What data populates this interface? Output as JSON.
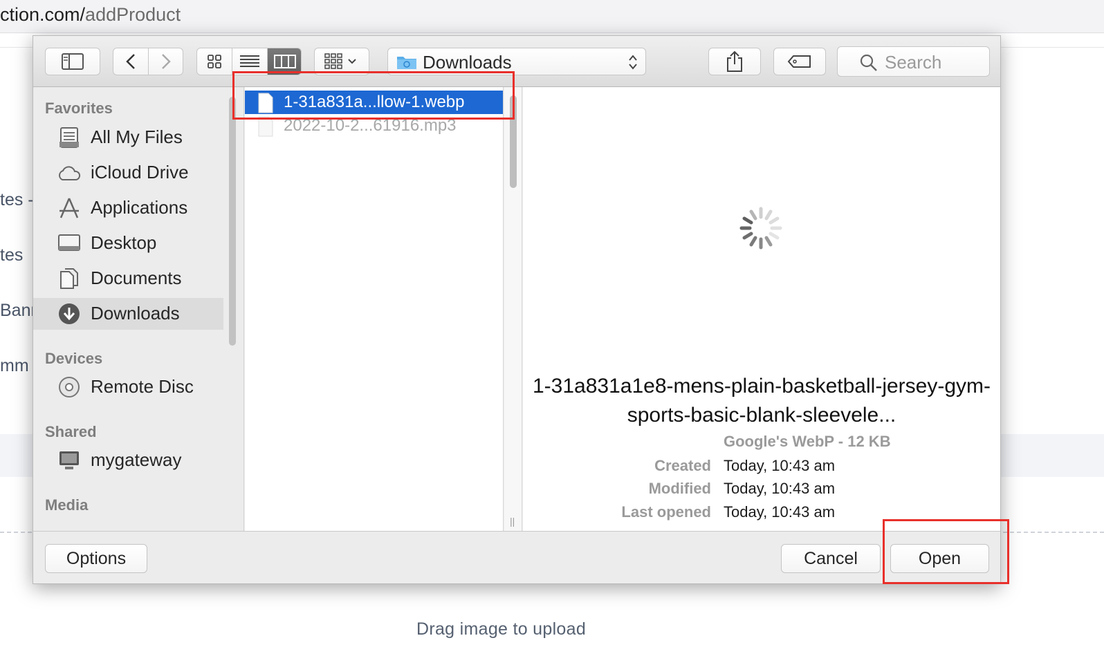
{
  "browser": {
    "url_host": "ction.com/",
    "url_path": "addProduct",
    "side_texts": [
      "tes -",
      "tes",
      "Bann",
      "mm"
    ],
    "drag_text": "Drag image to upload"
  },
  "dialog": {
    "toolbar": {
      "location": "Downloads",
      "search_placeholder": "Search"
    },
    "sidebar": {
      "sections": [
        {
          "title": "Favorites",
          "items": [
            {
              "label": "All My Files",
              "icon": "all-files-icon"
            },
            {
              "label": "iCloud Drive",
              "icon": "cloud-icon"
            },
            {
              "label": "Applications",
              "icon": "applications-icon"
            },
            {
              "label": "Desktop",
              "icon": "desktop-icon"
            },
            {
              "label": "Documents",
              "icon": "documents-icon"
            },
            {
              "label": "Downloads",
              "icon": "download-icon",
              "selected": true
            }
          ]
        },
        {
          "title": "Devices",
          "items": [
            {
              "label": "Remote Disc",
              "icon": "disc-icon"
            }
          ]
        },
        {
          "title": "Shared",
          "items": [
            {
              "label": "mygateway",
              "icon": "computer-icon"
            }
          ]
        },
        {
          "title": "Media",
          "items": []
        }
      ]
    },
    "files": [
      {
        "name": "1-31a831a...llow-1.webp",
        "selected": true
      },
      {
        "name": "2022-10-2...61916.mp3",
        "selected": false
      }
    ],
    "preview": {
      "title": "1-31a831a1e8-mens-plain-basketball-jersey-gym-sports-basic-blank-sleevele...",
      "kind": "Google's WebP - 12 KB",
      "details": [
        {
          "key": "Created",
          "value": "Today, 10:43 am"
        },
        {
          "key": "Modified",
          "value": "Today, 10:43 am"
        },
        {
          "key": "Last opened",
          "value": "Today, 10:43 am"
        }
      ]
    },
    "buttons": {
      "options": "Options",
      "cancel": "Cancel",
      "open": "Open"
    }
  },
  "colors": {
    "selection": "#1d68d3",
    "highlight_box": "#e8302b"
  }
}
